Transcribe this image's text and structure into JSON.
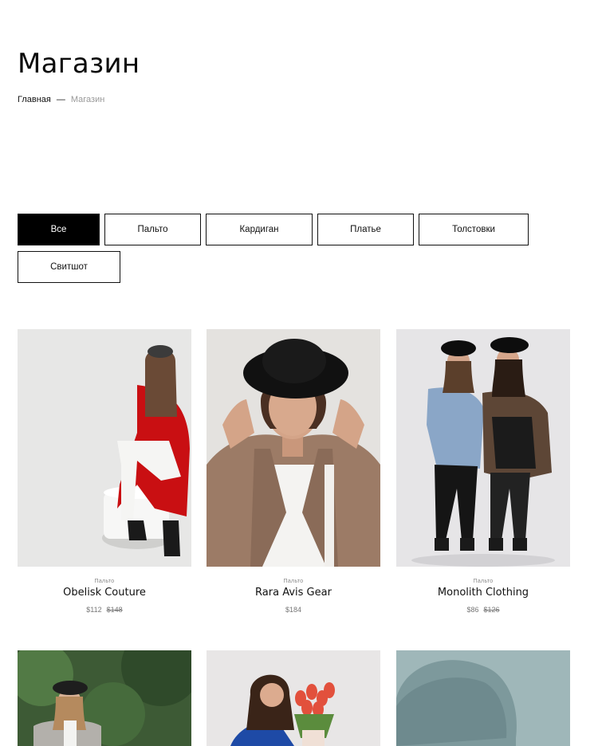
{
  "page": {
    "title": "Магазин"
  },
  "breadcrumb": {
    "home": "Главная",
    "separator": "—",
    "current": "Магазин"
  },
  "filters": [
    {
      "label": "Все",
      "active": true
    },
    {
      "label": "Пальто",
      "active": false
    },
    {
      "label": "Кардиган",
      "active": false
    },
    {
      "label": "Платье",
      "active": false
    },
    {
      "label": "Толстовки",
      "active": false
    },
    {
      "label": "Свитшот",
      "active": false
    }
  ],
  "products": [
    {
      "category": "Пальто",
      "name": "Obelisk Couture",
      "price": "$112",
      "old_price": "$148"
    },
    {
      "category": "Пальто",
      "name": "Rara Avis Gear",
      "price": "$184",
      "old_price": ""
    },
    {
      "category": "Пальто",
      "name": "Monolith Clothing",
      "price": "$86",
      "old_price": "$126"
    }
  ],
  "colors": {
    "accent": "#000000",
    "text": "#111111",
    "muted": "#888888"
  }
}
